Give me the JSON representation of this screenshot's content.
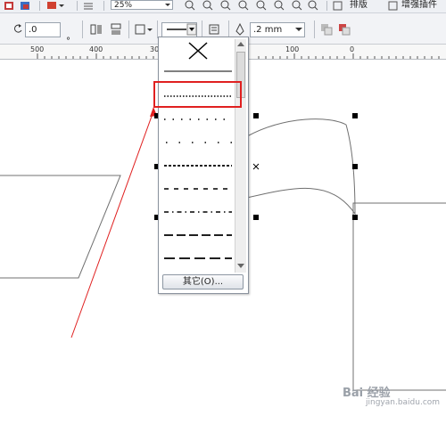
{
  "toolbar_top": {
    "zoom_value": "25%",
    "arrange_label": "排版",
    "plugins_label": "增强插件"
  },
  "property_bar": {
    "angle_value": ".0",
    "angle_unit": "°",
    "outline_width": ".2 mm"
  },
  "ruler": {
    "labels": [
      "500",
      "400",
      "300",
      "200",
      "100",
      "0"
    ]
  },
  "line_style_dropdown": {
    "none_symbol": "✕",
    "styles": [
      "solid",
      "fine-dotted",
      "dotted",
      "sparse-dotted",
      "dense-dashed",
      "short-dashed",
      "dash-dot",
      "long-dashed",
      "extra-long-dashed"
    ],
    "selected_index": 1,
    "other_button": "其它(O)..."
  },
  "colors": {
    "highlight": "#e02020",
    "arrow": "#e02020"
  },
  "watermark": {
    "text": "Bai 经验",
    "sub": "jingyan.baidu.com"
  }
}
